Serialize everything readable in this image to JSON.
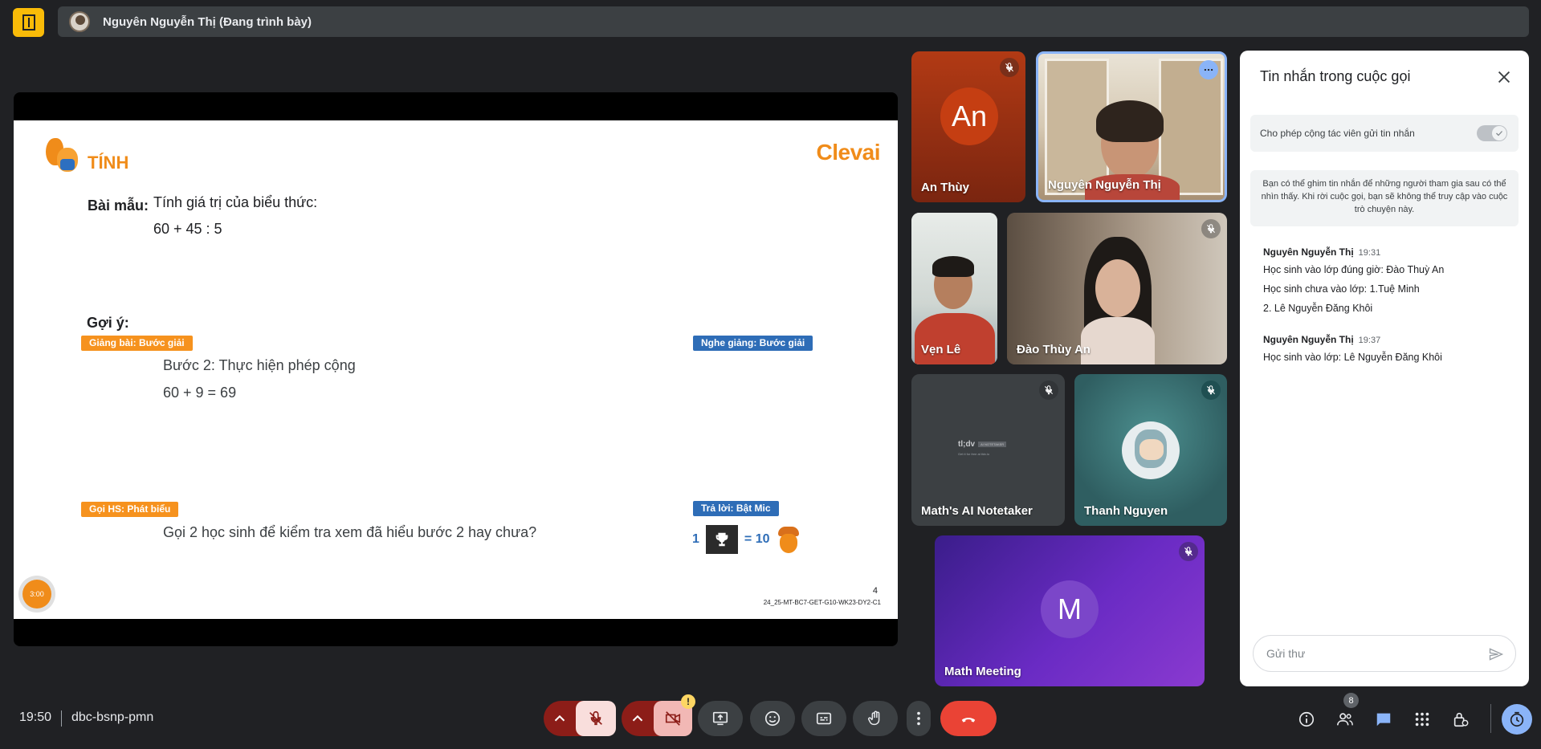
{
  "header": {
    "presenter": "Nguyên Nguyễn Thị (Đang trình bày)"
  },
  "slide": {
    "brand_left": "TÍNH",
    "brand_right": "Clevai",
    "sample_label": "Bài mẫu:",
    "sample_text": "Tính giá trị của biểu thức:",
    "sample_expr": "60 + 45 : 5",
    "hint_label": "Gợi ý:",
    "tag_teach": "Giảng bài: Bước giải",
    "tag_listen": "Nghe giảng: Bước giải",
    "step_text": "Bước 2: Thực hiện phép cộng",
    "step_expr": "60 + 9 = 69",
    "tag_call": "Gọi HS: Phát biểu",
    "tag_answer": "Trả lời: Bật Mic",
    "call_text": "Gọi 2 học sinh để kiểm tra xem đã hiểu bước 2 hay chưa?",
    "reward_left": "1",
    "reward_right": "= 10",
    "timer": "3:00",
    "page_number": "4",
    "slide_code": "24_25-MT-BC7-GET-G10-WK23-DY2-C1"
  },
  "participants": [
    {
      "name": "An Thùy",
      "initials": "An"
    },
    {
      "name": "Nguyên Nguyễn Thị"
    },
    {
      "name": "Vẹn Lê"
    },
    {
      "name": "Đào Thùy An"
    },
    {
      "name": "Math's AI Notetaker",
      "logo_text": "tl;dv",
      "logo_sub": "AI NOTETAKER",
      "logo_tagline": "Get it for free at tldv.io"
    },
    {
      "name": "Thanh Nguyen"
    },
    {
      "name": "Math Meeting",
      "initials": "M"
    }
  ],
  "chat": {
    "title": "Tin nhắn trong cuộc gọi",
    "allow_label": "Cho phép cộng tác viên gửi tin nhắn",
    "notice": "Bạn có thể ghim tin nhắn để những người tham gia sau có thể nhìn thấy. Khi rời cuộc gọi, bạn sẽ không thể truy cập vào cuộc trò chuyện này.",
    "messages": [
      {
        "author": "Nguyên Nguyễn Thị",
        "time": "19:31",
        "lines": [
          "Học sinh vào lớp đúng giờ: Đào Thuỳ An",
          "Học sinh chưa vào lớp: 1.Tuệ Minh",
          "2. Lê Nguyễn Đăng Khôi"
        ]
      },
      {
        "author": "Nguyên Nguyễn Thị",
        "time": "19:37",
        "lines": [
          "Học sinh vào lớp: Lê Nguyễn Đăng Khôi"
        ]
      }
    ],
    "input_placeholder": "Gửi thư"
  },
  "footer": {
    "time": "19:50",
    "meeting_code": "dbc-bsnp-pmn",
    "people_count": "8",
    "warning_badge": "!"
  },
  "colors": {
    "accent_orange": "#f08c1a",
    "tag_blue": "#2e6db7",
    "end_call_red": "#ea4335",
    "mic_off_bg": "#f9dedc",
    "chat_blue": "#8ab4f8"
  }
}
